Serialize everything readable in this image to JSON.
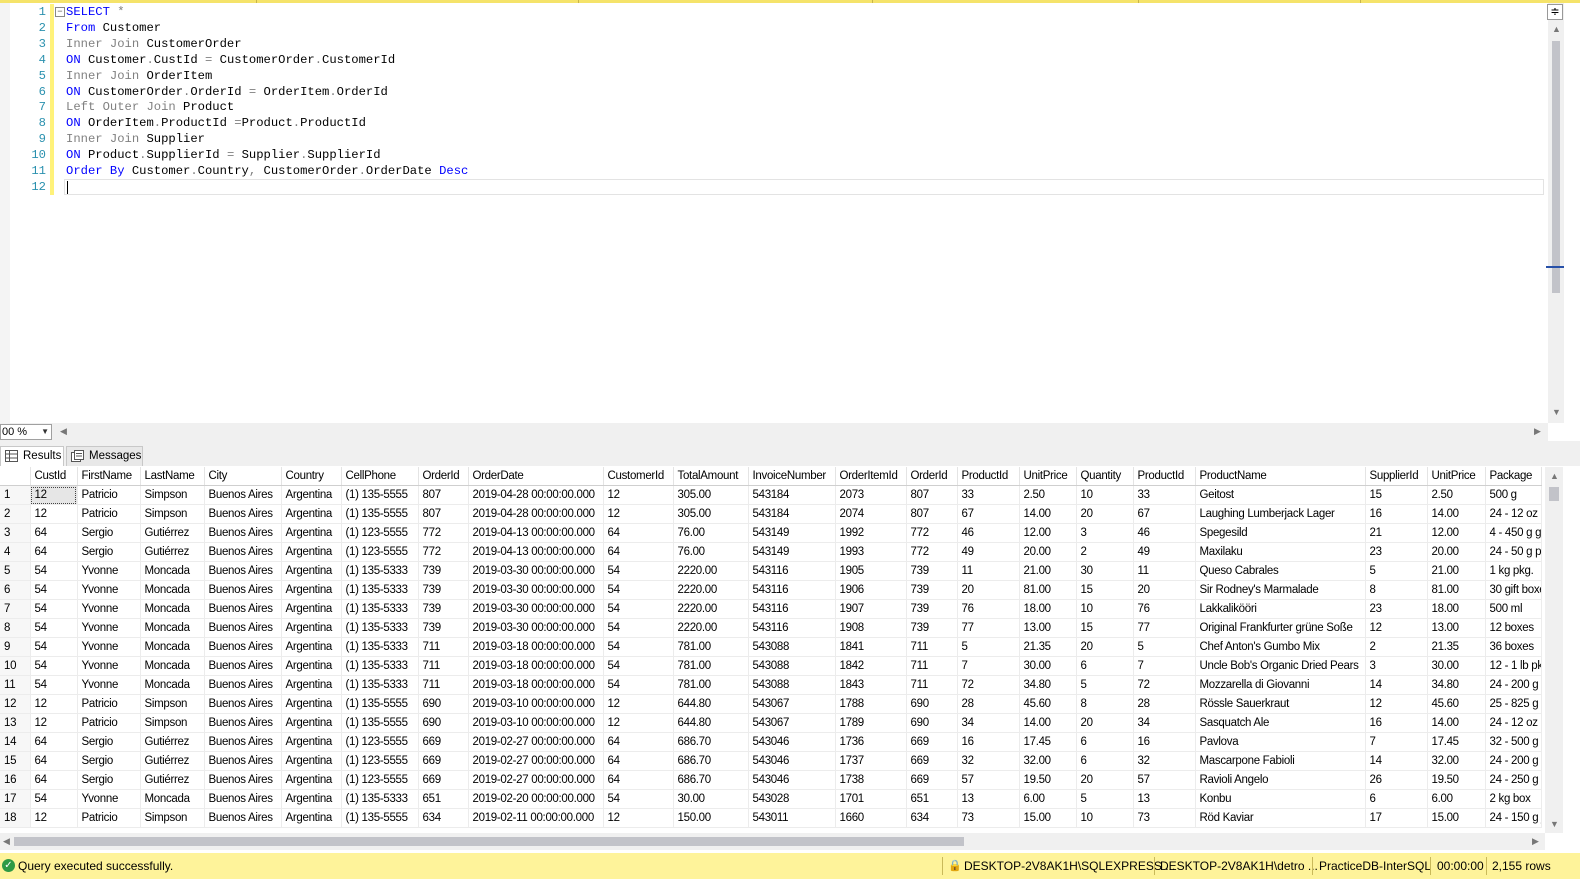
{
  "editor": {
    "line_numbers": [
      "1",
      "2",
      "3",
      "4",
      "5",
      "6",
      "7",
      "8",
      "9",
      "10",
      "11",
      "12"
    ],
    "code_lines": [
      [
        {
          "t": "SELECT ",
          "c": "kw"
        },
        {
          "t": "*",
          "c": "op"
        }
      ],
      [
        {
          "t": "From ",
          "c": "kw"
        },
        {
          "t": "Customer",
          "c": "id"
        }
      ],
      [
        {
          "t": "Inner Join ",
          "c": "jn"
        },
        {
          "t": "CustomerOrder",
          "c": "id"
        }
      ],
      [
        {
          "t": "ON ",
          "c": "kw"
        },
        {
          "t": "Customer",
          "c": "id"
        },
        {
          "t": ".",
          "c": "op"
        },
        {
          "t": "CustId ",
          "c": "id"
        },
        {
          "t": "= ",
          "c": "op"
        },
        {
          "t": "CustomerOrder",
          "c": "id"
        },
        {
          "t": ".",
          "c": "op"
        },
        {
          "t": "CustomerId",
          "c": "id"
        }
      ],
      [
        {
          "t": "Inner Join ",
          "c": "jn"
        },
        {
          "t": "OrderItem",
          "c": "id"
        }
      ],
      [
        {
          "t": "ON ",
          "c": "kw"
        },
        {
          "t": "CustomerOrder",
          "c": "id"
        },
        {
          "t": ".",
          "c": "op"
        },
        {
          "t": "OrderId ",
          "c": "id"
        },
        {
          "t": "= ",
          "c": "op"
        },
        {
          "t": "OrderItem",
          "c": "id"
        },
        {
          "t": ".",
          "c": "op"
        },
        {
          "t": "OrderId",
          "c": "id"
        }
      ],
      [
        {
          "t": "Left Outer Join ",
          "c": "jn"
        },
        {
          "t": "Product",
          "c": "id"
        }
      ],
      [
        {
          "t": "ON ",
          "c": "kw"
        },
        {
          "t": "OrderItem",
          "c": "id"
        },
        {
          "t": ".",
          "c": "op"
        },
        {
          "t": "ProductId ",
          "c": "id"
        },
        {
          "t": "=",
          "c": "op"
        },
        {
          "t": "Product",
          "c": "id"
        },
        {
          "t": ".",
          "c": "op"
        },
        {
          "t": "ProductId",
          "c": "id"
        }
      ],
      [
        {
          "t": "Inner Join ",
          "c": "jn"
        },
        {
          "t": "Supplier",
          "c": "id"
        }
      ],
      [
        {
          "t": "ON ",
          "c": "kw"
        },
        {
          "t": "Product",
          "c": "id"
        },
        {
          "t": ".",
          "c": "op"
        },
        {
          "t": "SupplierId ",
          "c": "id"
        },
        {
          "t": "= ",
          "c": "op"
        },
        {
          "t": "Supplier",
          "c": "id"
        },
        {
          "t": ".",
          "c": "op"
        },
        {
          "t": "SupplierId",
          "c": "id"
        }
      ],
      [
        {
          "t": "Order By ",
          "c": "kw"
        },
        {
          "t": "Customer",
          "c": "id"
        },
        {
          "t": ".",
          "c": "op"
        },
        {
          "t": "Country",
          "c": "id"
        },
        {
          "t": ", ",
          "c": "op"
        },
        {
          "t": "CustomerOrder",
          "c": "id"
        },
        {
          "t": ".",
          "c": "op"
        },
        {
          "t": "OrderDate ",
          "c": "id"
        },
        {
          "t": "Desc",
          "c": "kw"
        }
      ],
      []
    ]
  },
  "zoom": {
    "value": "00 %"
  },
  "tabs": {
    "results": "Results",
    "messages": "Messages"
  },
  "grid": {
    "columns": [
      "CustId",
      "FirstName",
      "LastName",
      "City",
      "Country",
      "CellPhone",
      "OrderId",
      "OrderDate",
      "CustomerId",
      "TotalAmount",
      "InvoiceNumber",
      "OrderItemId",
      "OrderId",
      "ProductId",
      "UnitPrice",
      "Quantity",
      "ProductId",
      "ProductName",
      "SupplierId",
      "UnitPrice",
      "Package"
    ],
    "rows": [
      [
        "1",
        "12",
        "Patricio",
        "Simpson",
        "Buenos Aires",
        "Argentina",
        "(1) 135-5555",
        "807",
        "2019-04-28 00:00:00.000",
        "12",
        "305.00",
        "543184",
        "2073",
        "807",
        "33",
        "2.50",
        "10",
        "33",
        "Geitost",
        "15",
        "2.50",
        "500 g"
      ],
      [
        "2",
        "12",
        "Patricio",
        "Simpson",
        "Buenos Aires",
        "Argentina",
        "(1) 135-5555",
        "807",
        "2019-04-28 00:00:00.000",
        "12",
        "305.00",
        "543184",
        "2074",
        "807",
        "67",
        "14.00",
        "20",
        "67",
        "Laughing Lumberjack Lager",
        "16",
        "14.00",
        "24 - 12 oz b"
      ],
      [
        "3",
        "64",
        "Sergio",
        "Gutiérrez",
        "Buenos Aires",
        "Argentina",
        "(1) 123-5555",
        "772",
        "2019-04-13 00:00:00.000",
        "64",
        "76.00",
        "543149",
        "1992",
        "772",
        "46",
        "12.00",
        "3",
        "46",
        "Spegesild",
        "21",
        "12.00",
        "4 - 450 g gla"
      ],
      [
        "4",
        "64",
        "Sergio",
        "Gutiérrez",
        "Buenos Aires",
        "Argentina",
        "(1) 123-5555",
        "772",
        "2019-04-13 00:00:00.000",
        "64",
        "76.00",
        "543149",
        "1993",
        "772",
        "49",
        "20.00",
        "2",
        "49",
        "Maxilaku",
        "23",
        "20.00",
        "24 - 50 g pk"
      ],
      [
        "5",
        "54",
        "Yvonne",
        "Moncada",
        "Buenos Aires",
        "Argentina",
        "(1) 135-5333",
        "739",
        "2019-03-30 00:00:00.000",
        "54",
        "2220.00",
        "543116",
        "1905",
        "739",
        "11",
        "21.00",
        "30",
        "11",
        "Queso Cabrales",
        "5",
        "21.00",
        "1 kg pkg."
      ],
      [
        "6",
        "54",
        "Yvonne",
        "Moncada",
        "Buenos Aires",
        "Argentina",
        "(1) 135-5333",
        "739",
        "2019-03-30 00:00:00.000",
        "54",
        "2220.00",
        "543116",
        "1906",
        "739",
        "20",
        "81.00",
        "15",
        "20",
        "Sir Rodney's Marmalade",
        "8",
        "81.00",
        "30 gift boxe"
      ],
      [
        "7",
        "54",
        "Yvonne",
        "Moncada",
        "Buenos Aires",
        "Argentina",
        "(1) 135-5333",
        "739",
        "2019-03-30 00:00:00.000",
        "54",
        "2220.00",
        "543116",
        "1907",
        "739",
        "76",
        "18.00",
        "10",
        "76",
        "Lakkalikööri",
        "23",
        "18.00",
        "500 ml"
      ],
      [
        "8",
        "54",
        "Yvonne",
        "Moncada",
        "Buenos Aires",
        "Argentina",
        "(1) 135-5333",
        "739",
        "2019-03-30 00:00:00.000",
        "54",
        "2220.00",
        "543116",
        "1908",
        "739",
        "77",
        "13.00",
        "15",
        "77",
        "Original Frankfurter grüne Soße",
        "12",
        "13.00",
        "12 boxes"
      ],
      [
        "9",
        "54",
        "Yvonne",
        "Moncada",
        "Buenos Aires",
        "Argentina",
        "(1) 135-5333",
        "711",
        "2019-03-18 00:00:00.000",
        "54",
        "781.00",
        "543088",
        "1841",
        "711",
        "5",
        "21.35",
        "20",
        "5",
        "Chef Anton's Gumbo Mix",
        "2",
        "21.35",
        "36 boxes"
      ],
      [
        "10",
        "54",
        "Yvonne",
        "Moncada",
        "Buenos Aires",
        "Argentina",
        "(1) 135-5333",
        "711",
        "2019-03-18 00:00:00.000",
        "54",
        "781.00",
        "543088",
        "1842",
        "711",
        "7",
        "30.00",
        "6",
        "7",
        "Uncle Bob's Organic Dried Pears",
        "3",
        "30.00",
        "12 - 1 lb pkg"
      ],
      [
        "11",
        "54",
        "Yvonne",
        "Moncada",
        "Buenos Aires",
        "Argentina",
        "(1) 135-5333",
        "711",
        "2019-03-18 00:00:00.000",
        "54",
        "781.00",
        "543088",
        "1843",
        "711",
        "72",
        "34.80",
        "5",
        "72",
        "Mozzarella di Giovanni",
        "14",
        "34.80",
        "24 - 200 g p"
      ],
      [
        "12",
        "12",
        "Patricio",
        "Simpson",
        "Buenos Aires",
        "Argentina",
        "(1) 135-5555",
        "690",
        "2019-03-10 00:00:00.000",
        "12",
        "644.80",
        "543067",
        "1788",
        "690",
        "28",
        "45.60",
        "8",
        "28",
        "Rössle Sauerkraut",
        "12",
        "45.60",
        "25 - 825 g c"
      ],
      [
        "13",
        "12",
        "Patricio",
        "Simpson",
        "Buenos Aires",
        "Argentina",
        "(1) 135-5555",
        "690",
        "2019-03-10 00:00:00.000",
        "12",
        "644.80",
        "543067",
        "1789",
        "690",
        "34",
        "14.00",
        "20",
        "34",
        "Sasquatch Ale",
        "16",
        "14.00",
        "24 - 12 oz b"
      ],
      [
        "14",
        "64",
        "Sergio",
        "Gutiérrez",
        "Buenos Aires",
        "Argentina",
        "(1) 123-5555",
        "669",
        "2019-02-27 00:00:00.000",
        "64",
        "686.70",
        "543046",
        "1736",
        "669",
        "16",
        "17.45",
        "6",
        "16",
        "Pavlova",
        "7",
        "17.45",
        "32 - 500 g b"
      ],
      [
        "15",
        "64",
        "Sergio",
        "Gutiérrez",
        "Buenos Aires",
        "Argentina",
        "(1) 123-5555",
        "669",
        "2019-02-27 00:00:00.000",
        "64",
        "686.70",
        "543046",
        "1737",
        "669",
        "32",
        "32.00",
        "6",
        "32",
        "Mascarpone Fabioli",
        "14",
        "32.00",
        "24 - 200 g p"
      ],
      [
        "16",
        "64",
        "Sergio",
        "Gutiérrez",
        "Buenos Aires",
        "Argentina",
        "(1) 123-5555",
        "669",
        "2019-02-27 00:00:00.000",
        "64",
        "686.70",
        "543046",
        "1738",
        "669",
        "57",
        "19.50",
        "20",
        "57",
        "Ravioli Angelo",
        "26",
        "19.50",
        "24 - 250 g p"
      ],
      [
        "17",
        "54",
        "Yvonne",
        "Moncada",
        "Buenos Aires",
        "Argentina",
        "(1) 135-5333",
        "651",
        "2019-02-20 00:00:00.000",
        "54",
        "30.00",
        "543028",
        "1701",
        "651",
        "13",
        "6.00",
        "5",
        "13",
        "Konbu",
        "6",
        "6.00",
        "2 kg box"
      ],
      [
        "18",
        "12",
        "Patricio",
        "Simpson",
        "Buenos Aires",
        "Argentina",
        "(1) 135-5555",
        "634",
        "2019-02-11 00:00:00.000",
        "12",
        "150.00",
        "543011",
        "1660",
        "634",
        "73",
        "15.00",
        "10",
        "73",
        "Röd Kaviar",
        "17",
        "15.00",
        "24 - 150 g ja"
      ]
    ]
  },
  "status": {
    "message": "Query executed successfully.",
    "server": "DESKTOP-2V8AK1H\\SQLEXPRESS ...",
    "user": "DESKTOP-2V8AK1H\\detro ...",
    "database": "PracticeDB-InterSQL",
    "elapsed": "00:00:00",
    "rows": "2,155 rows"
  },
  "colors": {
    "status_bar": "#fef39a",
    "keyword": "#0000ff",
    "line_number": "#2b91af",
    "ok_icon": "#2f9a45"
  }
}
